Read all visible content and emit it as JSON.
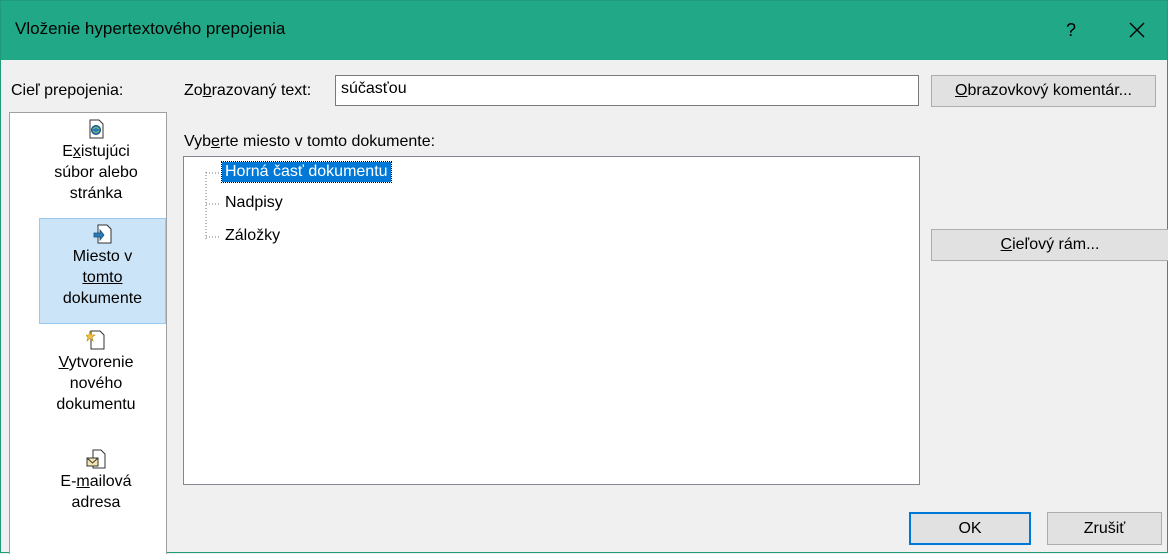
{
  "window": {
    "title": "Vloženie hypertextového prepojenia",
    "help_glyph": "?",
    "close_glyph": "close-icon"
  },
  "link_to": {
    "label": "Cieľ prepojenia:",
    "items": [
      {
        "pre": "E",
        "key": "x",
        "post": "istujúci",
        "line2": "súbor alebo",
        "line3": "stránka",
        "icon": "existing-file-icon",
        "selected": false
      },
      {
        "pre": "",
        "key": "",
        "post": "Miesto v",
        "line2": "tomto",
        "line2_underlined": true,
        "line3": "dokumente",
        "icon": "place-in-document-icon",
        "selected": true
      },
      {
        "pre": "",
        "key": "V",
        "post": "ytvorenie",
        "line2": "nového",
        "line3": "dokumentu",
        "icon": "new-document-icon",
        "selected": false
      },
      {
        "pre": "E-",
        "key": "m",
        "post": "ailová",
        "line2": "adresa",
        "line3": "",
        "icon": "email-address-icon",
        "selected": false
      }
    ]
  },
  "display_text": {
    "label_pre": "Zo",
    "label_key": "b",
    "label_post": "razovaný text:",
    "value": "súčasťou"
  },
  "screentip_button": {
    "key": "O",
    "rest": "brazovkový komentár..."
  },
  "place": {
    "label_pre": "Vyb",
    "label_key": "e",
    "label_post": "rte miesto v tomto dokumente:",
    "nodes": [
      {
        "label": "Horná časť dokumentu",
        "selected": true
      },
      {
        "label": "Nadpisy",
        "selected": false
      },
      {
        "label": "Záložky",
        "selected": false
      }
    ]
  },
  "target_frame_button": {
    "key": "C",
    "rest": "ieľový rám..."
  },
  "ok_button": "OK",
  "cancel_button": "Zrušiť",
  "colors": {
    "titlebar": "#20a887",
    "selection": "#0078d7",
    "sidebar_selected": "#cce4f7"
  }
}
